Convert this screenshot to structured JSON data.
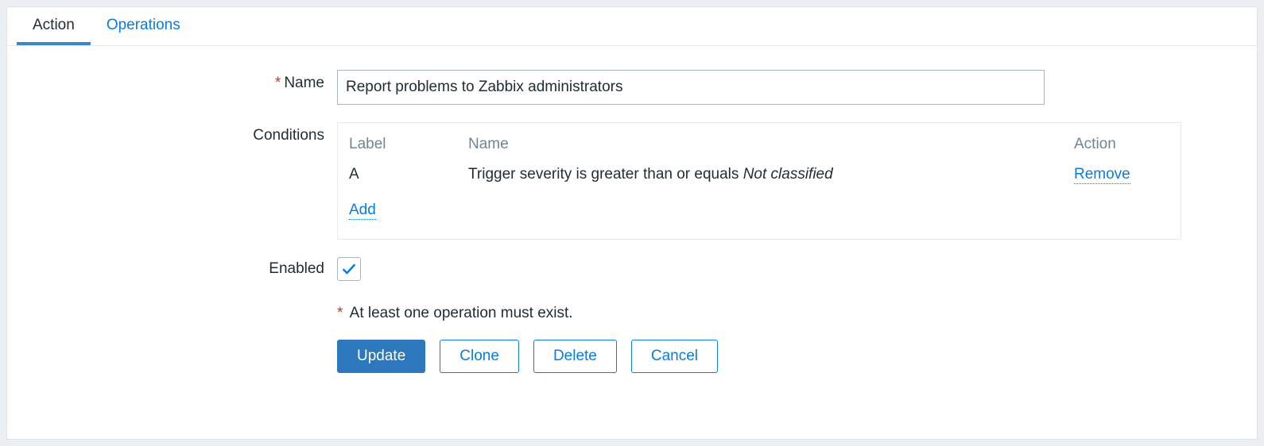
{
  "tabs": {
    "action": "Action",
    "operations": "Operations"
  },
  "form": {
    "name_label": "Name",
    "name_value": "Report problems to Zabbix administrators",
    "conditions_label": "Conditions",
    "enabled_label": "Enabled",
    "enabled_checked": true
  },
  "conditions": {
    "header_label": "Label",
    "header_name": "Name",
    "header_action": "Action",
    "rows": [
      {
        "label": "A",
        "name_prefix": "Trigger severity is greater than or equals ",
        "name_italic": "Not classified",
        "remove": "Remove"
      }
    ],
    "add_label": "Add"
  },
  "hint": {
    "text": "At least one operation must exist."
  },
  "buttons": {
    "update": "Update",
    "clone": "Clone",
    "delete": "Delete",
    "cancel": "Cancel"
  },
  "colors": {
    "link": "#0a7be0",
    "primary": "#2d78bd"
  }
}
